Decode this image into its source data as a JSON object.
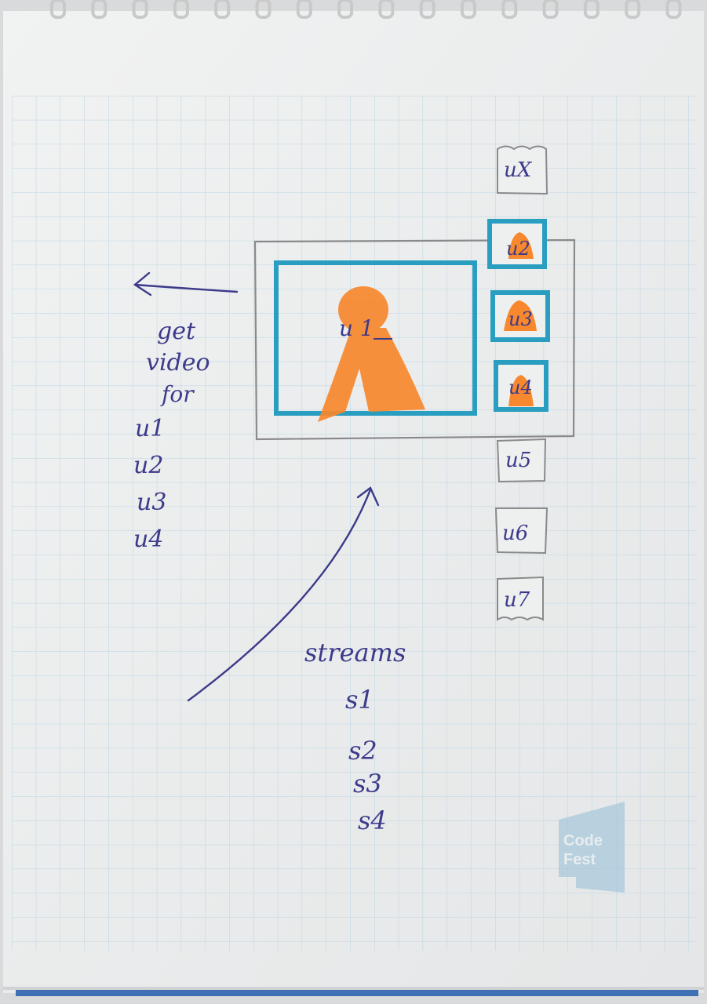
{
  "colors": {
    "paper": "#eef0f0",
    "grid": "#b9d3e2",
    "pencil": "#8a8a8c",
    "cyan_marker": "#2a9ec0",
    "orange_marker": "#f7882e",
    "ink": "#3d3a8a",
    "binding": "#c9c9c9",
    "page_edge_blue": "#3f6fb5",
    "watermark": "#aac9dc"
  },
  "main_view": {
    "label": "u 1"
  },
  "thumbnails": [
    {
      "label": "uX",
      "highlighted": false
    },
    {
      "label": "u2",
      "highlighted": true
    },
    {
      "label": "u3",
      "highlighted": true
    },
    {
      "label": "u4",
      "highlighted": true
    },
    {
      "label": "u5",
      "highlighted": false
    },
    {
      "label": "u6",
      "highlighted": false
    },
    {
      "label": "u7",
      "highlighted": false
    }
  ],
  "left_note": {
    "lines": [
      "get",
      "video",
      "for",
      "u1",
      "u2",
      "u3",
      "u4"
    ]
  },
  "streams_note": {
    "title": "streams",
    "items": [
      "s1",
      "s2",
      "s3",
      "s4"
    ]
  },
  "watermark": {
    "lines": [
      "Code",
      "Fest"
    ]
  },
  "icons": {
    "left_arrow": "arrow-left-icon",
    "curved_arrow": "arrow-curved-up-icon",
    "person": "person-silhouette-icon"
  }
}
